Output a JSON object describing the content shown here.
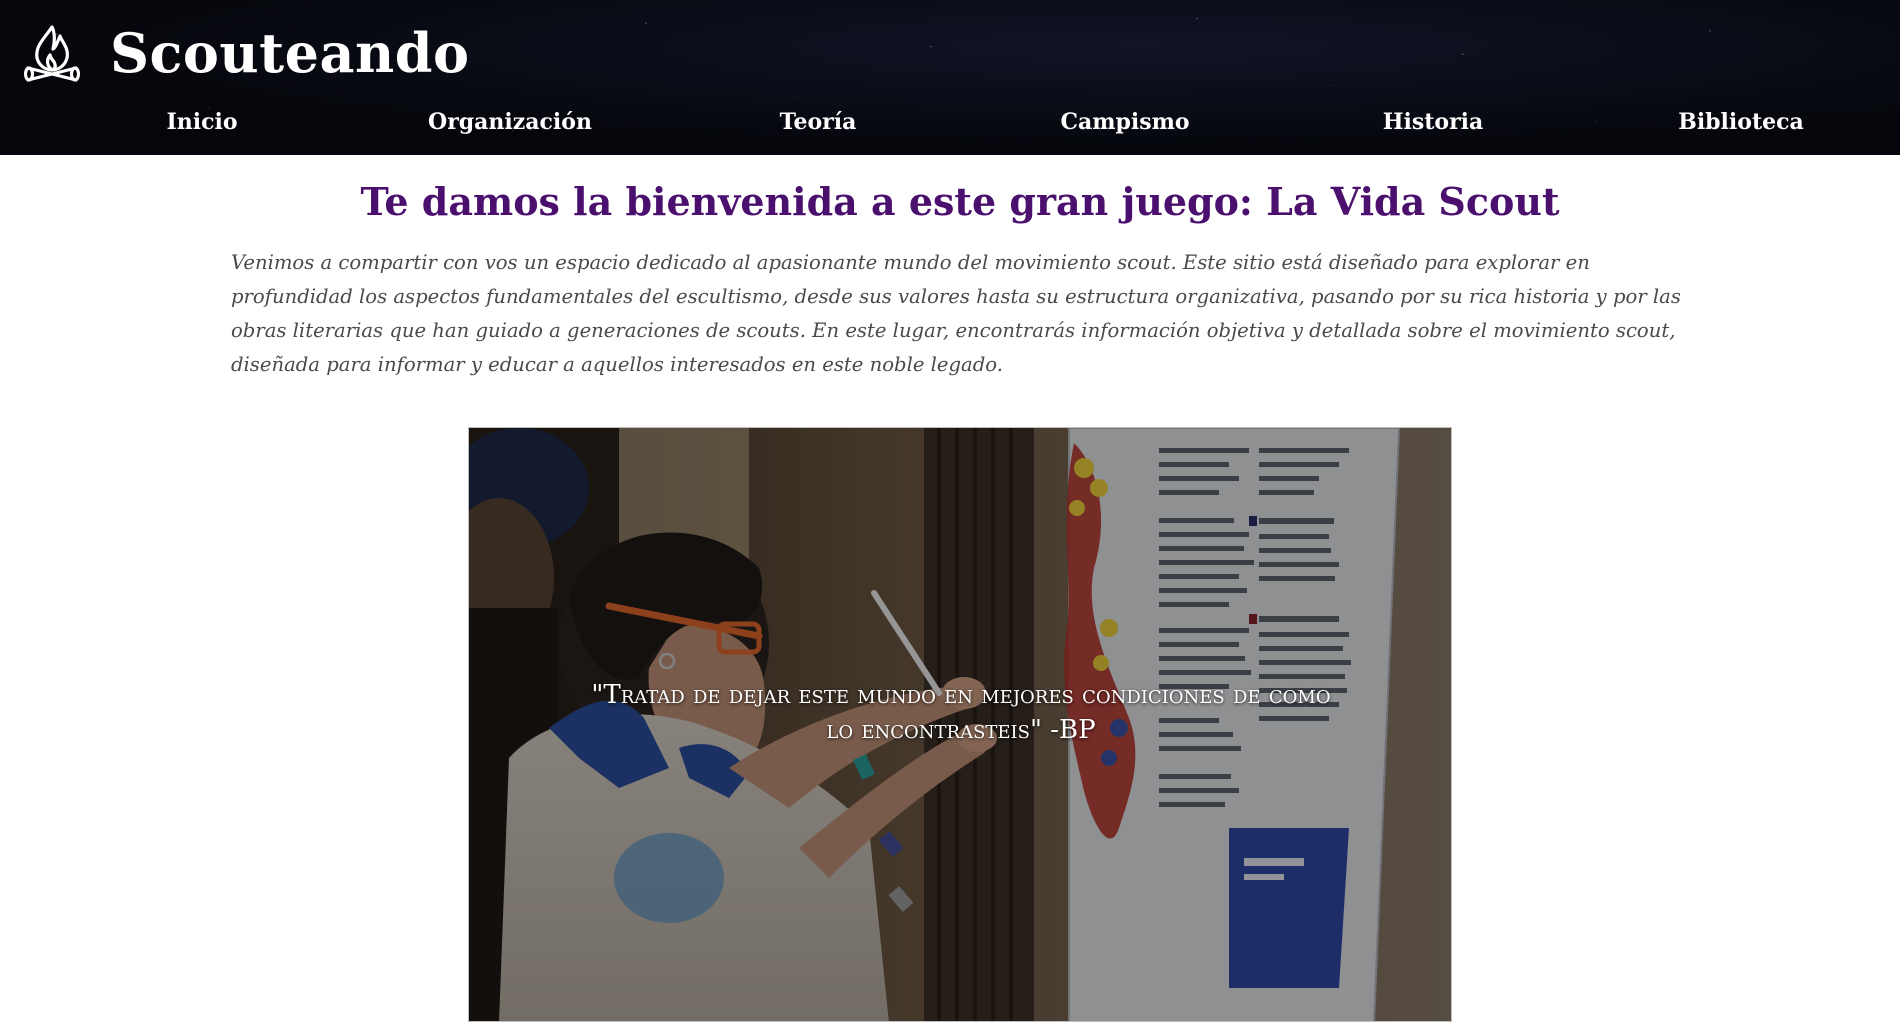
{
  "header": {
    "logo_icon": "campfire-icon",
    "site_name": "Scouteando"
  },
  "nav": {
    "items": [
      {
        "label": "Inicio"
      },
      {
        "label": "Organización"
      },
      {
        "label": "Teoría"
      },
      {
        "label": "Campismo"
      },
      {
        "label": "Historia"
      },
      {
        "label": "Biblioteca"
      }
    ]
  },
  "main": {
    "title": "Te damos la bienvenida a este gran juego: La Vida Scout",
    "intro": "Venimos a compartir con vos un espacio dedicado al apasionante mundo del movimiento scout. Este sitio está diseñado para explorar en profundidad los aspectos fundamentales del escultismo, desde sus valores hasta su estructura organizativa, pasando por su rica historia y por las obras literarias que han guiado a generaciones de scouts. En este lugar, encontrarás información objetiva y detallada sobre el movimiento scout, diseñada para informar y educar a aquellos interesados en este noble legado."
  },
  "hero": {
    "quote": "\"Tratad de dejar este mundo en mejores condiciones de como lo encontrasteis\" -BP"
  },
  "colors": {
    "header_bg": "#05060b",
    "title": "#4b0f6e",
    "intro_text": "#4a4a4a"
  }
}
